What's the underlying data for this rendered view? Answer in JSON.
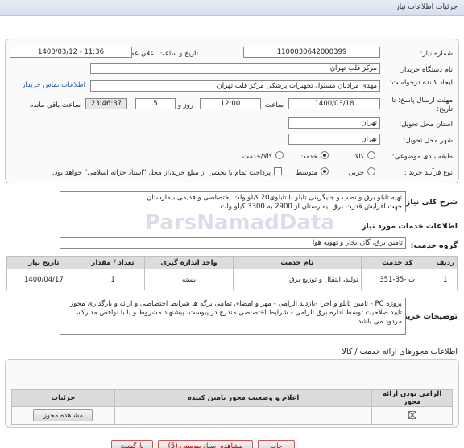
{
  "header": {
    "title": "جزئیات اطلاعات نیاز"
  },
  "form": {
    "need_number_label": "شماره نیاز:",
    "need_number": "1100030642000399",
    "announce_label": "تاریخ و ساعت اعلان عمومی:",
    "announce_value": "1400/03/12 - 11:36",
    "buyer_label": "نام دستگاه خریدار:",
    "buyer_value": "مرکز قلب تهران",
    "creator_label": "ایجاد کننده درخواست:",
    "creator_value": "مهدی مرادیان مسئول تجهیزات پزشکی مرکز قلب تهران",
    "contact_link": "اطلاعات تماس خریدار",
    "deadline_label": "مهلت ارسال پاسخ: تا تاریخ:",
    "deadline_date": "1400/03/18",
    "time_label": "ساعت",
    "deadline_time": "12:00",
    "days_value": "5",
    "days_label": "روز و",
    "remaining_time": "23:46:37",
    "remaining_label": "ساعت باقی مانده",
    "province_label": "استان محل تحویل:",
    "province_value": "تهران",
    "city_label": "شهر محل تحویل:",
    "city_value": "تهران",
    "category_label": "طبقه بندی موضوعی:",
    "category_options": [
      "کالا",
      "خدمت",
      "کالا/خدمت"
    ],
    "category_selected": "خدمت",
    "process_label": "نوع فرآیند خرید :",
    "process_options": [
      "جزیی",
      "متوسط"
    ],
    "process_selected": "متوسط",
    "payment_note": "پرداخت تمام یا بخشی از مبلغ خرید،از محل \"اسناد خزانه اسلامی\" خواهد بود."
  },
  "description": {
    "label": "شرح کلی نیاز:",
    "line1": "تهیه تابلو برق و نصب و جایگزینی تابلو با تابلوی20 کیلو ولت اختصاصی و  قدیمی بیمارستان",
    "line2": "جهت افزایش قدرت برق بیمارستان از 2900 به 3300 کیلو وات"
  },
  "services": {
    "section_title": "اطلاعات خدمات مورد نیاز",
    "group_label": "گروه خدمت:",
    "group_value": "تامین برق، گاز، بخار و تهویه هوا",
    "columns": [
      "ردیف",
      "کد خدمت",
      "نام خدمت",
      "واحد اندازه گیری",
      "تعداد / مقدار",
      "تاریخ نیاز"
    ],
    "rows": [
      [
        "1",
        "ت -35-351",
        "تولید، انتقال و توزیع برق",
        "بسته",
        "1",
        "1400/04/17"
      ]
    ]
  },
  "buyer_notes": {
    "label": "توضیحات خریدار:",
    "text": "پروژه  PC  - تامین تابلو  و اجرا -بازدید الزامی - مهر و امضای تمامی برگه ها شرایط اختصاصی و ارائه و بارگذاری مجوز تایید صلاحیت توسط اداره برق الزامی - شرایط اختصاصی مندرج در پیوست، پیشنهاد مشروط و یا با نواقص مدارک، مردود می باشد."
  },
  "permits": {
    "section_title": "اطلاعات مجوزهای ارائه خدمت / کالا",
    "columns": [
      "الزامی بودن ارائه مجوز",
      "اعلام و وضعیت مجوز تامین کننده",
      "جزئیات"
    ],
    "rows": [
      {
        "required": "",
        "status": "",
        "details_button": "مشاهده مجوز"
      }
    ]
  },
  "footer": {
    "buttons": [
      "بازگشت",
      "مشاهده اسناد پیوستی (5)",
      "چاپ"
    ]
  },
  "watermark": "ParsNamadData"
}
